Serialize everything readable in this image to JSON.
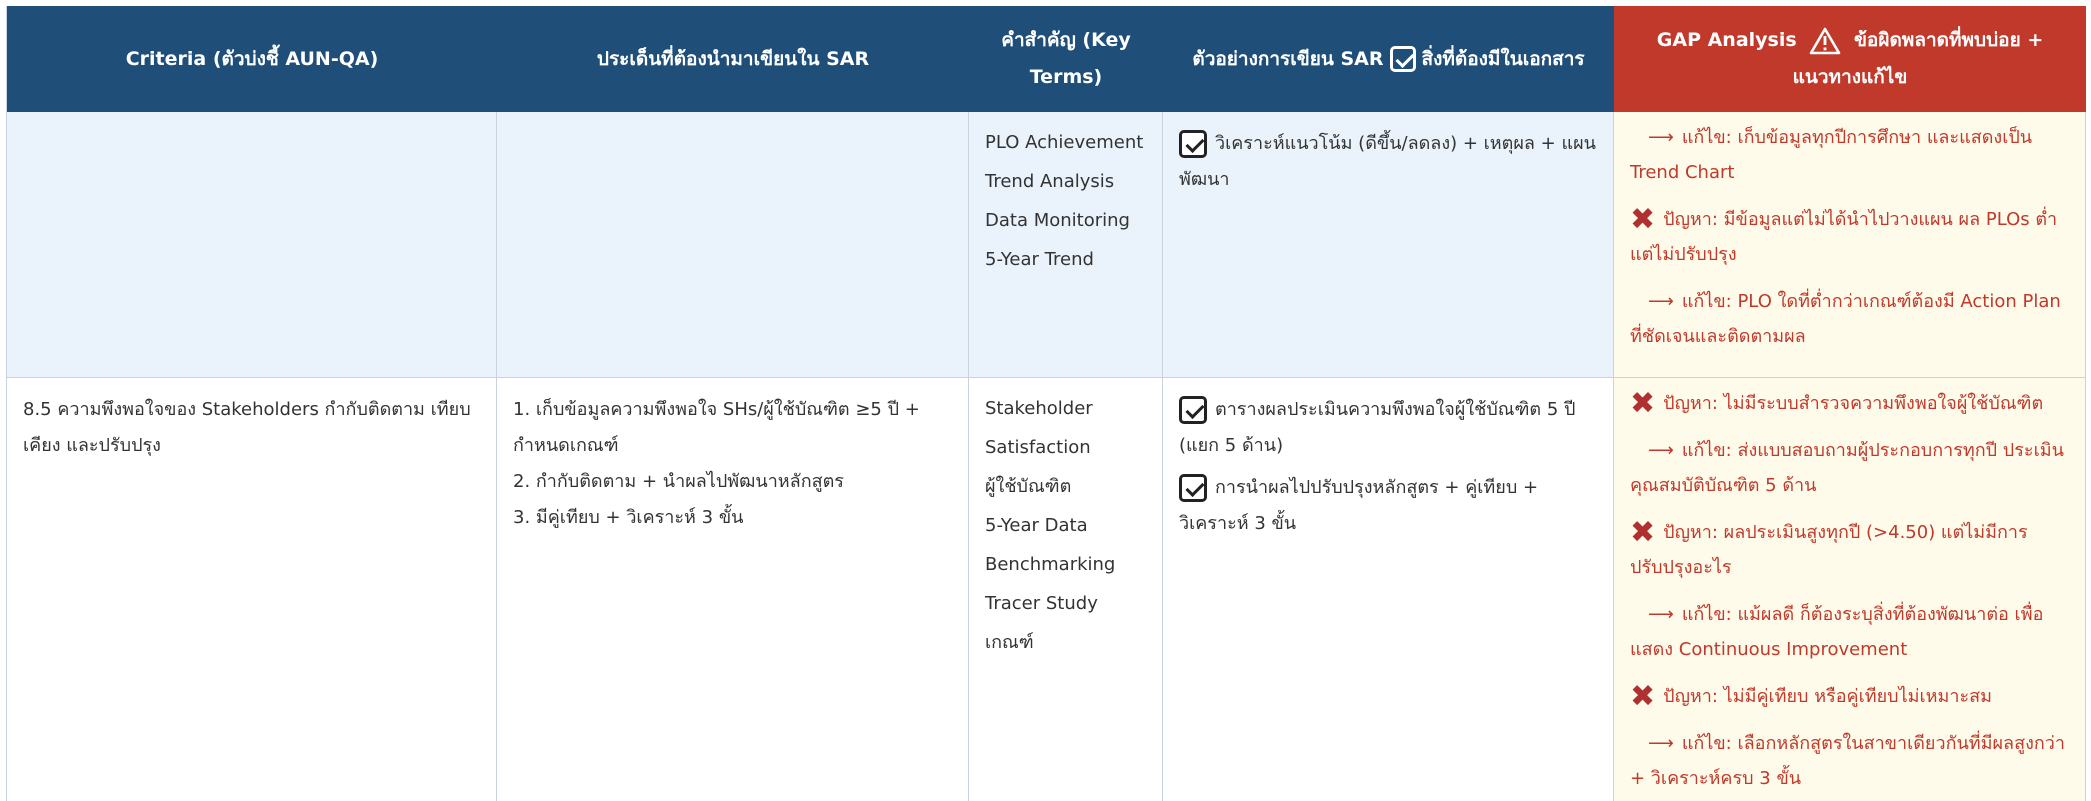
{
  "header": {
    "col1": "Criteria (ตัวบ่งชี้ AUN-QA)",
    "col2": "ประเด็นที่ต้องนำมาเขียนใน SAR",
    "col3": "คำสำคัญ (Key Terms)",
    "col4_a": "ตัวอย่างการเขียน SAR",
    "col4_b": "สิ่งที่ต้องมีในเอกสาร",
    "col5_a": "GAP Analysis",
    "col5_b": "ข้อผิดพลาดที่พบบ่อย + แนวทางแก้ไข"
  },
  "rows": [
    {
      "criteria": "",
      "points": [],
      "key_terms": [
        "PLO Achievement",
        "Trend Analysis",
        "Data Monitoring",
        "5-Year Trend"
      ],
      "examples": [
        "วิเคราะห์แนวโน้ม (ดีขึ้น/ลดลง) + เหตุผล + แผนพัฒนา"
      ],
      "gaps": [
        {
          "kind": "fix",
          "text": "แก้ไข: เก็บข้อมูลทุกปีการศึกษา และแสดงเป็น Trend Chart"
        },
        {
          "kind": "problem",
          "text": "ปัญหา: มีข้อมูลแต่ไม่ได้นำไปวางแผน ผล PLOs ต่ำแต่ไม่ปรับปรุง"
        },
        {
          "kind": "fix",
          "text": "แก้ไข: PLO ใดที่ต่ำกว่าเกณฑ์ต้องมี Action Plan ที่ชัดเจนและติดตามผล"
        }
      ]
    },
    {
      "criteria": "8.5 ความพึงพอใจของ Stakeholders กำกับติดตาม เทียบเคียง และปรับปรุง",
      "points": [
        "1. เก็บข้อมูลความพึงพอใจ SHs/ผู้ใช้บัณฑิต ≥5 ปี + กำหนดเกณฑ์",
        "2. กำกับติดตาม + นำผลไปพัฒนาหลักสูตร",
        "3. มีคู่เทียบ + วิเคราะห์ 3 ขั้น"
      ],
      "key_terms": [
        "Stakeholder",
        "Satisfaction",
        "ผู้ใช้บัณฑิต",
        "5-Year Data",
        "Benchmarking",
        "Tracer Study",
        "เกณฑ์"
      ],
      "examples": [
        "ตารางผลประเมินความพึงพอใจผู้ใช้บัณฑิต 5 ปี (แยก 5 ด้าน)",
        "การนำผลไปปรับปรุงหลักสูตร + คู่เทียบ + วิเคราะห์ 3 ขั้น"
      ],
      "gaps": [
        {
          "kind": "problem",
          "text": "ปัญหา: ไม่มีระบบสำรวจความพึงพอใจผู้ใช้บัณฑิต"
        },
        {
          "kind": "fix",
          "text": "แก้ไข: ส่งแบบสอบถามผู้ประกอบการทุกปี ประเมินคุณสมบัติบัณฑิต 5 ด้าน"
        },
        {
          "kind": "problem",
          "text": "ปัญหา: ผลประเมินสูงทุกปี (>4.50) แต่ไม่มีการปรับปรุงอะไร"
        },
        {
          "kind": "fix",
          "text": "แก้ไข: แม้ผลดี ก็ต้องระบุสิ่งที่ต้องพัฒนาต่อ เพื่อแสดง Continuous Improvement"
        },
        {
          "kind": "problem",
          "text": "ปัญหา: ไม่มีคู่เทียบ หรือคู่เทียบไม่เหมาะสม"
        },
        {
          "kind": "fix",
          "text": "แก้ไข: เลือกหลักสูตรในสาขาเดียวกันที่มีผลสูงกว่า + วิเคราะห์ครบ 3 ขั้น"
        }
      ]
    }
  ],
  "colors": {
    "header": "#1f4e79",
    "gap_header": "#c0392b",
    "row_alt": "#eaf2fb",
    "gap_bg": "#fffbea",
    "gap_text": "#c0392b"
  },
  "icons": {
    "check": "checkbox-check-icon",
    "problem": "cross-icon",
    "fix": "arrow-right-icon",
    "warning": "warning-icon"
  }
}
